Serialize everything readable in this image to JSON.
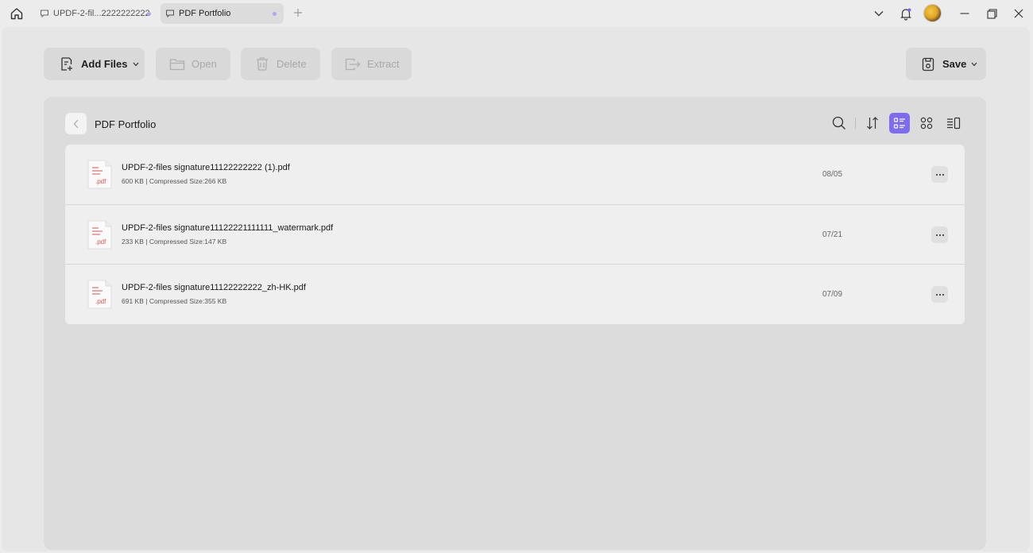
{
  "titlebar": {
    "tabs": [
      {
        "label": "UPDF-2-fil...2222222222"
      },
      {
        "label": "PDF Portfolio"
      }
    ],
    "icons": [
      "home-icon",
      "comment-icon",
      "plus-icon",
      "chevron-down-icon",
      "bell-icon",
      "minimize-icon",
      "restore-icon",
      "close-icon"
    ]
  },
  "toolbar": {
    "add_files": "Add Files",
    "open": "Open",
    "delete": "Delete",
    "extract": "Extract",
    "save": "Save"
  },
  "panel": {
    "title": "PDF Portfolio",
    "view_controls": [
      "search-icon",
      "sort-icon",
      "list-view-icon",
      "grid-view-icon",
      "detail-view-icon"
    ],
    "selected_view": "list"
  },
  "files": [
    {
      "name": "UPDF-2-files signature11122222222 (1).pdf",
      "meta": "600 KB | Compressed Size:266 KB",
      "date": "08/05",
      "ext": ".pdf"
    },
    {
      "name": "UPDF-2-files signature11122221111111_watermark.pdf",
      "meta": "233 KB | Compressed Size:147 KB",
      "date": "07/21",
      "ext": ".pdf"
    },
    {
      "name": "UPDF-2-files signature11122222222_zh-HK.pdf",
      "meta": "691 KB | Compressed Size:355 KB",
      "date": "07/09",
      "ext": ".pdf"
    }
  ],
  "colors": {
    "accent": "#7b6cf0",
    "tab_dot": "#b3a6ee",
    "pdf_red": "#d9534f"
  }
}
